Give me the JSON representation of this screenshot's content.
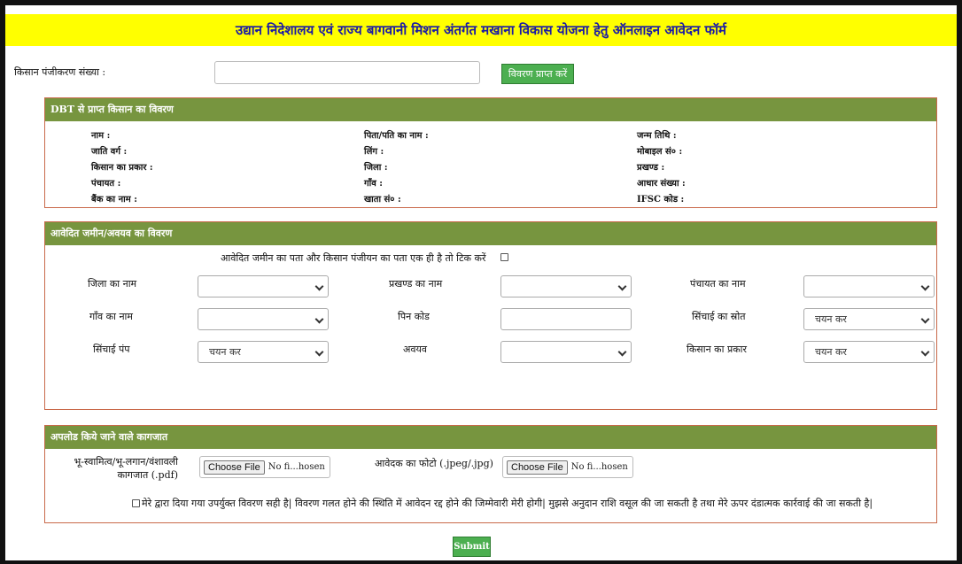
{
  "header": {
    "title": "उद्यान निदेशालय एवं राज्य बागवानी मिशन अंतर्गत मखाना विकास योजना हेतु ऑनलाइन आवेदन फॉर्म"
  },
  "registration": {
    "label": "किसान पंजीकरण संख्या :",
    "value": "",
    "button": "विवरण प्राप्त करें"
  },
  "dbt": {
    "heading": "DBT से प्राप्त किसान का विवरण",
    "fields": [
      [
        "नाम :",
        "पिता/पति का नाम :",
        "जन्म तिथि :"
      ],
      [
        "जाति वर्ग :",
        "लिंग :",
        "मोबाइल सं० :"
      ],
      [
        "किसान का प्रकार :",
        "जिला :",
        "प्रखण्ड :"
      ],
      [
        "पंचायत :",
        "गाँव :",
        "आधार संख्या :"
      ],
      [
        "बैंक का नाम :",
        "खाता सं० :",
        "IFSC कोड :"
      ]
    ]
  },
  "land": {
    "heading": "आवेदित जमीन/अवयव का विवरण",
    "same_address_label": "आवेदित जमीन का पता और किसान पंजीयन का पता एक ही है तो टिक करें",
    "district_label": "जिला का नाम",
    "block_label": "प्रखण्ड का नाम",
    "panchayat_label": "पंचायत का नाम",
    "village_label": "गाँव का नाम",
    "pincode_label": "पिन कोड",
    "irrigation_source_label": "सिंचाई का स्रोत",
    "irrigation_source_value": "चयन कर",
    "irrigation_pump_label": "सिंचाई पंप",
    "irrigation_pump_value": "चयन कर",
    "component_label": "अवयव",
    "farmer_type_label": "किसान का प्रकार",
    "farmer_type_value": "चयन कर"
  },
  "documents": {
    "heading": "अपलोड किये जाने वाले कागजात",
    "land_doc_label_1": "भू-स्वामित्व/भू-लगान/वंशावली",
    "land_doc_label_2": "कागजात (.pdf)",
    "photo_label": "आवेदक का फोटो (.jpeg/.jpg)",
    "choose_file": "Choose File",
    "no_file": "No fi...hosen",
    "declaration": "मेरे द्वारा दिया गया उपर्युक्त विवरण सही है| विवरण गलत होने की स्थिति में आवेदन रद्द होने की जिम्मेवारी मेरी होगी| मुझसे अनुदान राशि वसूल की जा सकती है तथा मेरे ऊपर दंडात्मक कार्रवाई की जा सकती है|"
  },
  "submit": {
    "label": "Submit"
  }
}
